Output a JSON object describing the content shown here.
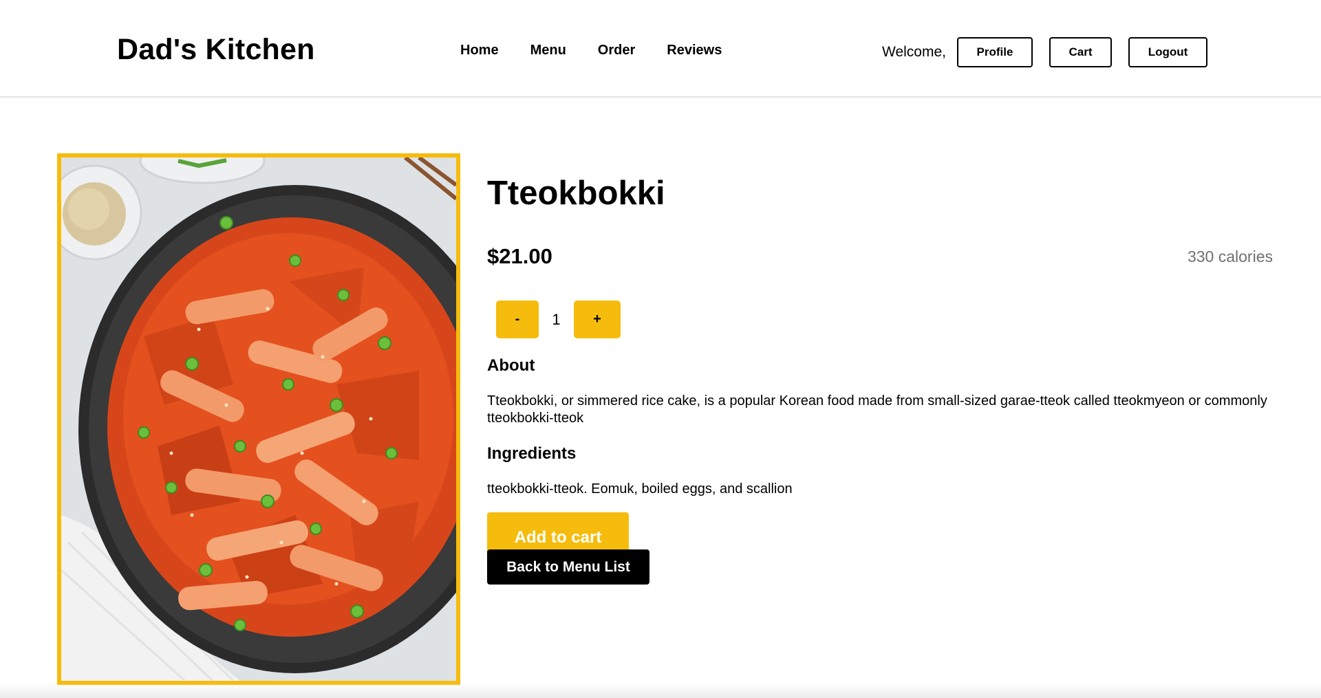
{
  "header": {
    "brand": "Dad's Kitchen",
    "nav": [
      "Home",
      "Menu",
      "Order",
      "Reviews"
    ],
    "welcome": "Welcome,",
    "buttons": {
      "profile": "Profile",
      "cart": "Cart",
      "logout": "Logout"
    }
  },
  "product": {
    "name": "Tteokbokki",
    "price": "$21.00",
    "calories": "330 calories",
    "quantity": {
      "decrement_label": "-",
      "value": "1",
      "increment_label": "+"
    },
    "about_heading": "About",
    "about_text": "Tteokbokki, or simmered rice cake, is a popular Korean food made from small-sized garae-tteok called tteokmyeon or commonly tteokbokki-tteok",
    "ingredients_heading": "Ingredients",
    "ingredients_text": "tteokbokki-tteok. Eomuk, boiled eggs, and scallion",
    "add_to_cart": "Add to cart",
    "back_to_menu": "Back to Menu List"
  },
  "colors": {
    "accent": "#f6bc0d",
    "text": "#000000",
    "muted": "#707070",
    "sauce": "#e4501e"
  },
  "image": {
    "icon": "food-photo-tteokbokki"
  }
}
